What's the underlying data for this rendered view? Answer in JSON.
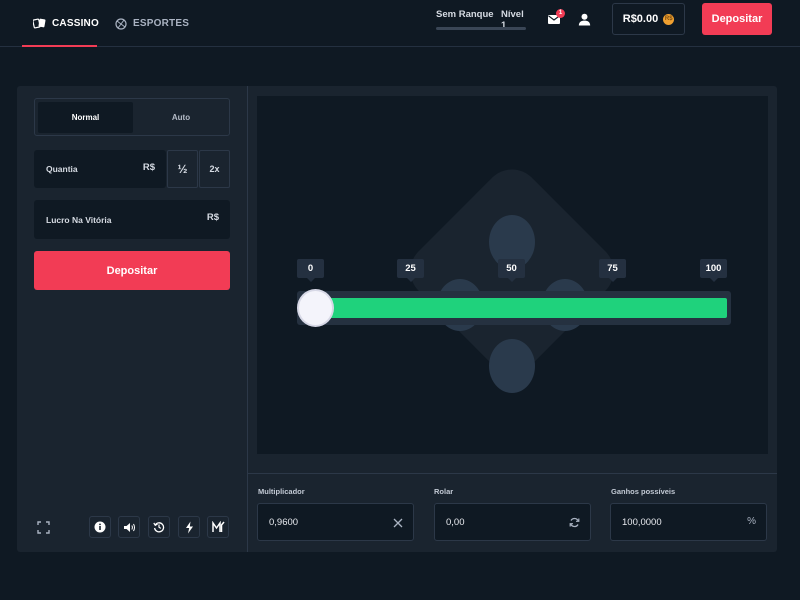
{
  "nav": {
    "tabs": [
      {
        "label": "CASSINO",
        "icon": "cards-icon",
        "active": true
      },
      {
        "label": "ESPORTES",
        "icon": "ball-icon",
        "active": false
      }
    ],
    "rank": {
      "label": "Sem Ranque",
      "level": "Nível 1"
    },
    "notifications_count": "1",
    "balance": "R$0.00",
    "coin_symbol": "R$",
    "deposit_label": "Depositar"
  },
  "bet": {
    "modes": [
      "Normal",
      "Auto"
    ],
    "active_mode": "Normal",
    "amount_label": "Quantia",
    "amount_currency": "R$",
    "half_label": "½",
    "double_label": "2x",
    "profit_label": "Lucro Na Vitória",
    "profit_currency": "R$",
    "deposit_label": "Depositar"
  },
  "tools": [
    "fullscreen-icon",
    "info-icon",
    "volume-icon",
    "history-icon",
    "lightning-icon",
    "fairness-icon"
  ],
  "slider": {
    "ticks": [
      "0",
      "25",
      "50",
      "75",
      "100"
    ],
    "value": 0,
    "win_color": "#1fd27c"
  },
  "stats": {
    "multiplier_label": "Multiplicador",
    "multiplier_value": "0,9600",
    "roll_label": "Rolar",
    "roll_value": "0,00",
    "chance_label": "Ganhos possíveis",
    "chance_value": "100,0000",
    "chance_suffix": "%"
  },
  "colors": {
    "accent": "#f23c55",
    "background": "#0f1923",
    "panel": "#1a242f",
    "success": "#1fd27c"
  }
}
